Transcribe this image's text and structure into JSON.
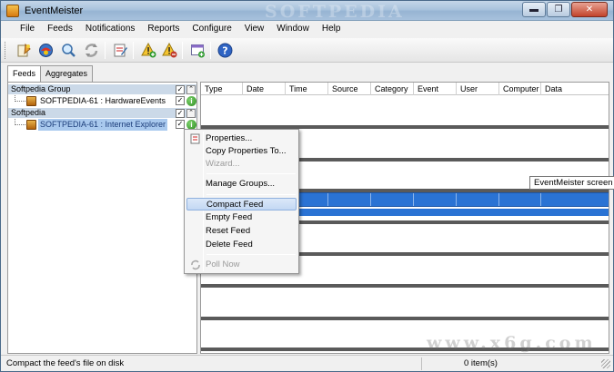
{
  "window": {
    "title": "EventMeister",
    "watermark": "SOFTPEDIA",
    "min_label": "▬",
    "max_label": "❐",
    "close_label": "✕"
  },
  "menubar": [
    "File",
    "Feeds",
    "Notifications",
    "Reports",
    "Configure",
    "View",
    "Window",
    "Help"
  ],
  "toolbar": {
    "icons": [
      "new-feed-icon",
      "feeds-icon",
      "find-icon",
      "refresh-icon",
      "edit-notification-icon",
      "add-alert-icon",
      "delete-alert-icon",
      "add-window-icon",
      "help-icon"
    ]
  },
  "tabs": [
    "Feeds",
    "Aggregates"
  ],
  "tree": {
    "groups": [
      {
        "name": "Softpedia Group",
        "feeds": [
          "SOFTPEDIA-61 : HardwareEvents"
        ]
      },
      {
        "name": "Softpedia",
        "feeds": [
          "SOFTPEDIA-61 : Internet Explorer"
        ]
      }
    ],
    "check_mark": "✓",
    "collapse_mark": "⌃",
    "info_mark": "i"
  },
  "grid": {
    "columns": [
      "Type",
      "Date",
      "Time",
      "Source",
      "Category",
      "Event",
      "User",
      "Computer",
      "Data"
    ]
  },
  "tooltip": "EventMeister screen",
  "context_menu": {
    "items": [
      {
        "label": "Properties...",
        "enabled": true
      },
      {
        "label": "Copy Properties To...",
        "enabled": true
      },
      {
        "label": "Wizard...",
        "enabled": false
      },
      {
        "label": "Manage Groups...",
        "enabled": true
      },
      {
        "label": "Compact Feed",
        "enabled": true,
        "highlighted": true
      },
      {
        "label": "Empty Feed",
        "enabled": true
      },
      {
        "label": "Reset Feed",
        "enabled": true
      },
      {
        "label": "Delete Feed",
        "enabled": true
      },
      {
        "label": "Poll Now",
        "enabled": false
      }
    ]
  },
  "statusbar": {
    "text": "Compact the feed's file on disk",
    "count": "0 item(s)",
    "site_watermark": "www.x6g.com"
  },
  "colors": {
    "selection": "#2a73d4",
    "group_header": "#cbd9e8",
    "menu_highlight": "#c3d8f3"
  }
}
